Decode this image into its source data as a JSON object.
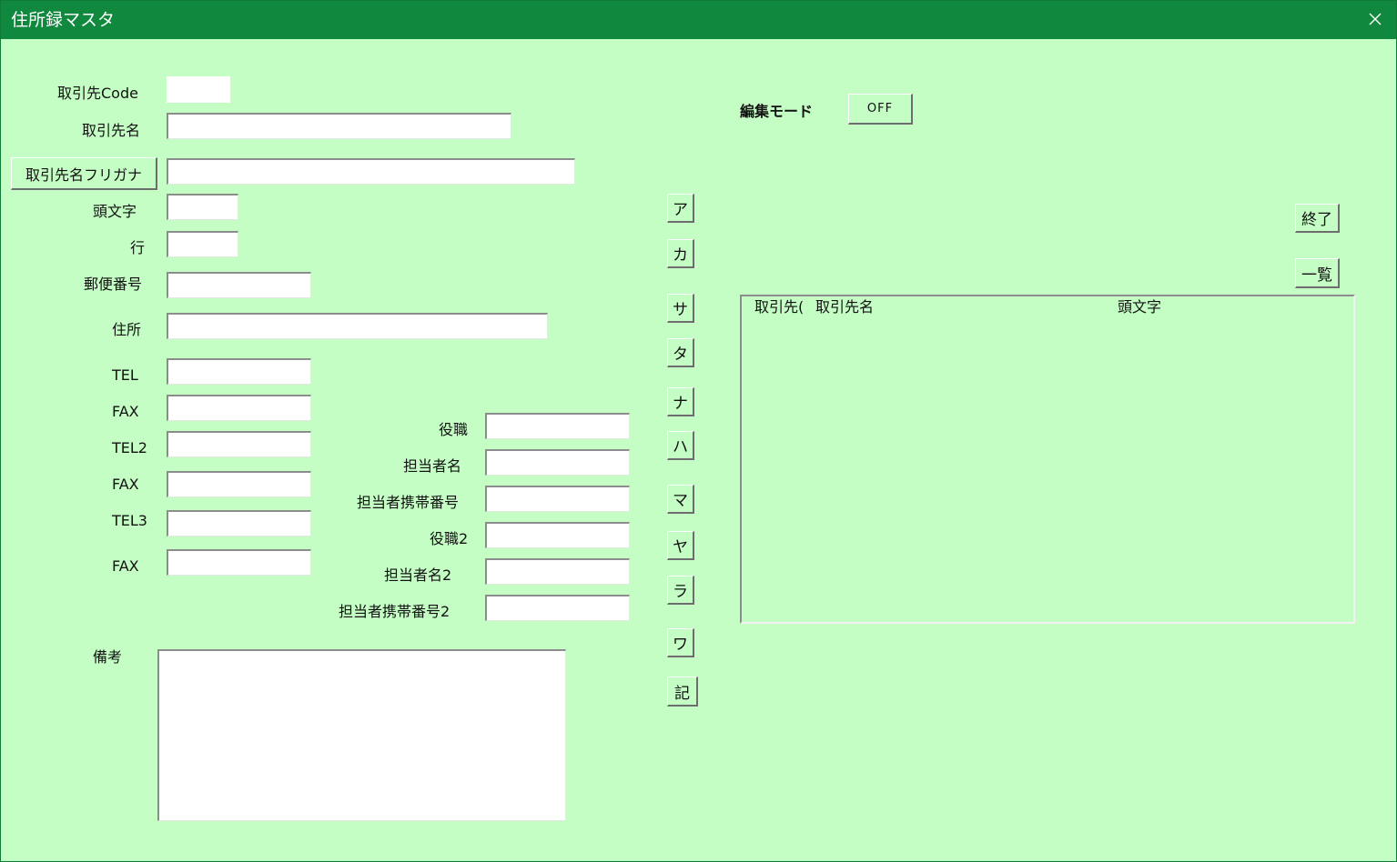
{
  "window": {
    "title": "住所録マスタ",
    "close_glyph": "✕"
  },
  "fields": {
    "code": {
      "label": "取引先Code",
      "value": ""
    },
    "name": {
      "label": "取引先名",
      "value": ""
    },
    "furigana": {
      "button_label": "取引先名フリガナ",
      "value": ""
    },
    "initial": {
      "label": "頭文字",
      "value": ""
    },
    "row": {
      "label": "行",
      "value": ""
    },
    "postal": {
      "label": "郵便番号",
      "value": ""
    },
    "address": {
      "label": "住所",
      "value": ""
    },
    "tel": {
      "label": "TEL",
      "value": ""
    },
    "fax": {
      "label": "FAX",
      "value": ""
    },
    "tel2": {
      "label": "TEL2",
      "value": ""
    },
    "fax2": {
      "label": "FAX",
      "value": ""
    },
    "tel3": {
      "label": "TEL3",
      "value": ""
    },
    "fax3": {
      "label": "FAX",
      "value": ""
    },
    "position": {
      "label": "役職",
      "value": ""
    },
    "contact": {
      "label": "担当者名",
      "value": ""
    },
    "mobile": {
      "label": "担当者携帯番号",
      "value": ""
    },
    "position2": {
      "label": "役職2",
      "value": ""
    },
    "contact2": {
      "label": "担当者名2",
      "value": ""
    },
    "mobile2": {
      "label": "担当者携帯番号2",
      "value": ""
    },
    "notes": {
      "label": "備考",
      "value": ""
    }
  },
  "edit_mode": {
    "label": "編集モード",
    "toggle": "OFF"
  },
  "kana_buttons": [
    "ア",
    "カ",
    "サ",
    "タ",
    "ナ",
    "ハ",
    "マ",
    "ヤ",
    "ラ",
    "ワ",
    "記"
  ],
  "actions": {
    "exit": "終了",
    "list": "一覧"
  },
  "list": {
    "columns": [
      "取引先(",
      "取引先名",
      "頭文字"
    ]
  }
}
